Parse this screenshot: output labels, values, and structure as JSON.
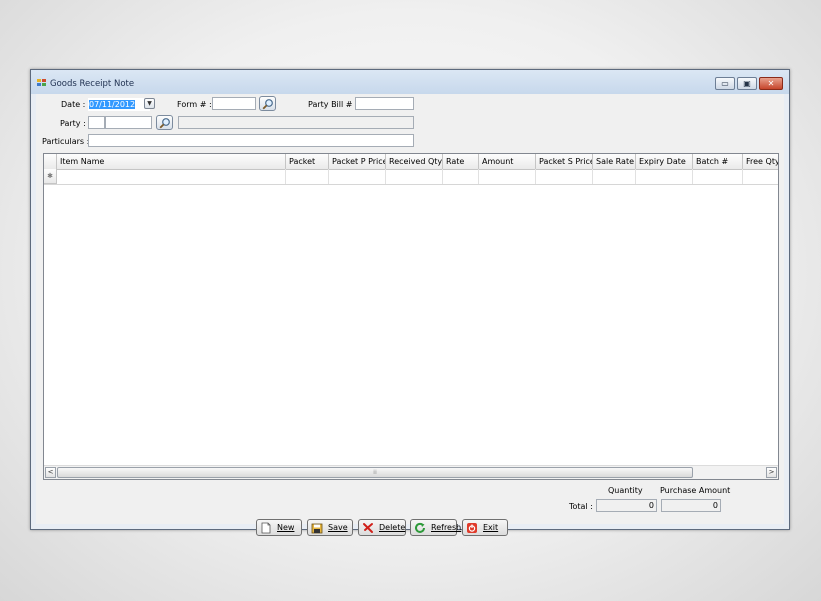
{
  "window": {
    "title": "Goods Receipt Note",
    "min_glyph": "▭",
    "max_glyph": "▣",
    "close_glyph": "✕"
  },
  "form": {
    "date_label": "Date :",
    "date_value": "07/11/2012",
    "form_no_label": "Form # :",
    "form_no_value": "",
    "party_bill_label": "Party Bill # :",
    "party_bill_value": "",
    "party_label": "Party :",
    "party_code_value": "",
    "party_id_value": "",
    "party_name_value": "",
    "particulars_label": "Particulars :",
    "particulars_value": ""
  },
  "grid": {
    "columns": [
      "Item Name",
      "Packet",
      "Packet P Price",
      "Received Qty",
      "Rate",
      "Amount",
      "Packet S Price",
      "Sale Rate",
      "Expiry Date",
      "Batch #",
      "Free Qty"
    ],
    "new_row_marker": "✱",
    "scroll_left": "<",
    "scroll_right": ">",
    "scroll_thumb_grip": "⁞⁞"
  },
  "buttons": {
    "new": "New",
    "save": "Save",
    "delete": "Delete",
    "refresh": "Refresh",
    "exit": "Exit"
  },
  "totals": {
    "quantity_label": "Quantity",
    "purchase_amount_label": "Purchase Amount",
    "total_label": "Total :",
    "quantity_value": "0",
    "purchase_amount_value": "0"
  },
  "colors": {
    "selection": "#3399ff",
    "title_text": "#1e2f4f",
    "close_button": "#c6452c"
  }
}
